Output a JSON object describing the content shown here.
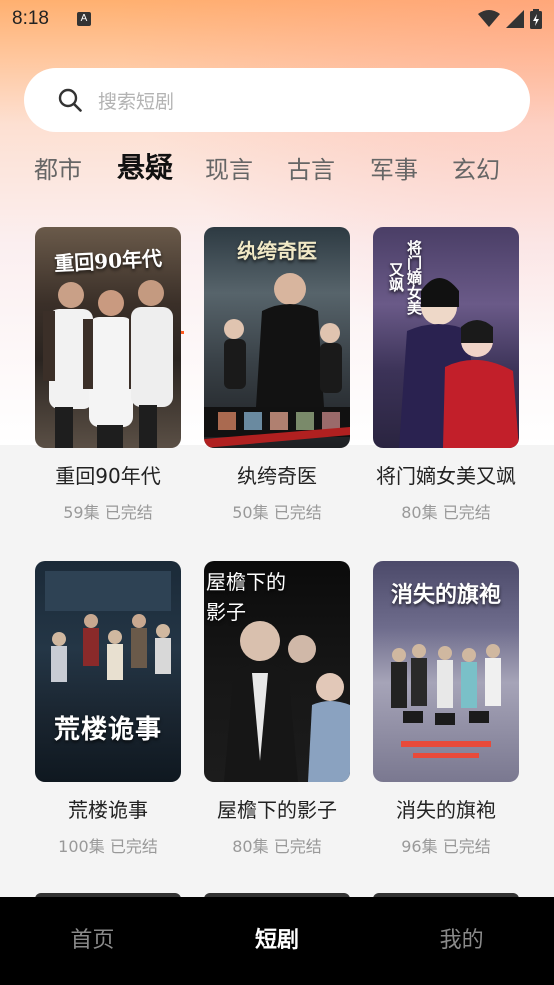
{
  "status_bar": {
    "time": "8:18",
    "notification_badge": "A"
  },
  "search": {
    "placeholder": "搜索短剧"
  },
  "tabs": [
    {
      "label": "都市",
      "active": false
    },
    {
      "label": "悬疑",
      "active": true
    },
    {
      "label": "现言",
      "active": false
    },
    {
      "label": "古言",
      "active": false
    },
    {
      "label": "军事",
      "active": false
    },
    {
      "label": "玄幻",
      "active": false
    }
  ],
  "dramas": [
    {
      "title": "重回90年代",
      "episodes": "59集",
      "status": "已完结",
      "poster_text": "重回90年代"
    },
    {
      "title": "纨绔奇医",
      "episodes": "50集",
      "status": "已完结",
      "poster_text": "纨绔奇医"
    },
    {
      "title": "将门嫡女美又飒",
      "episodes": "80集",
      "status": "已完结",
      "poster_text": "将门嫡女美又飒"
    },
    {
      "title": "荒楼诡事",
      "episodes": "100集",
      "status": "已完结",
      "poster_text": "荒楼诡事"
    },
    {
      "title": "屋檐下的影子",
      "episodes": "80集",
      "status": "已完结",
      "poster_text": "屋檐下的影子"
    },
    {
      "title": "消失的旗袍",
      "episodes": "96集",
      "status": "已完结",
      "poster_text": "消失的旗袍"
    }
  ],
  "bottom_nav": [
    {
      "label": "首页",
      "active": false
    },
    {
      "label": "短剧",
      "active": true
    },
    {
      "label": "我的",
      "active": false
    }
  ],
  "colors": {
    "accent": "#ff5a1f",
    "nav_bg": "#000000",
    "header_gradient_top": "#ffb070"
  }
}
